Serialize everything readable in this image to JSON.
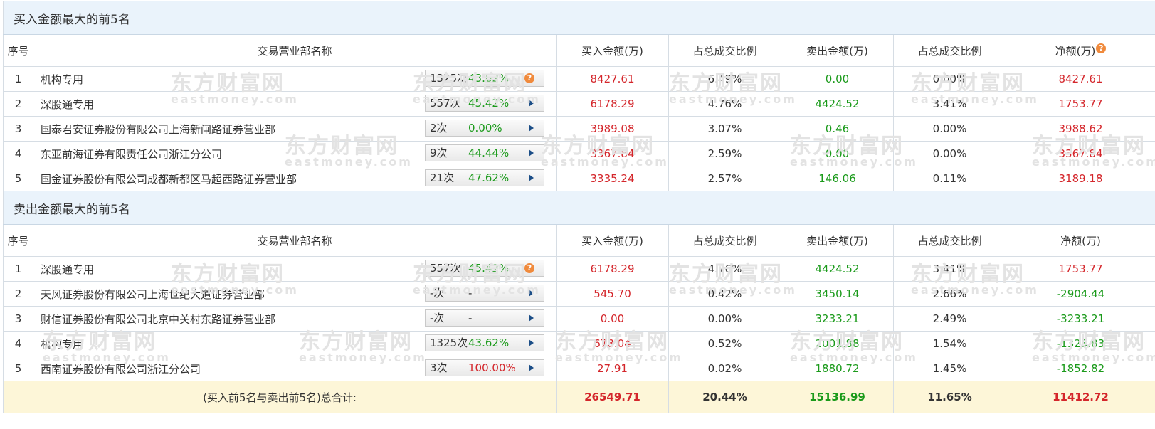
{
  "colors": {
    "up": "#d4262b",
    "down": "#1a9a1a",
    "header_bg": "#eaf3fb",
    "total_bg": "#fdf6d8"
  },
  "watermark": {
    "cn": "东方财富网",
    "en": "eastmoney.com"
  },
  "columns": [
    "序号",
    "交易营业部名称",
    "买入金额(万)",
    "占总成交比例",
    "卖出金额(万)",
    "占总成交比例",
    "净额(万)"
  ],
  "buy_section": {
    "title": "买入金额最大的前5名",
    "rows": [
      {
        "idx": "1",
        "name": "机构专用",
        "times": "1325次",
        "pct": "43.62%",
        "pct_color": "green",
        "icon": "question-icon",
        "buy": "8427.61",
        "buy_ratio": "6.49%",
        "sell": "0.00",
        "sell_ratio": "0.00%",
        "net": "8427.61",
        "net_color": "red"
      },
      {
        "idx": "2",
        "name": "深股通专用",
        "times": "557次",
        "pct": "45.42%",
        "pct_color": "green",
        "icon": "arrow-right-icon",
        "buy": "6178.29",
        "buy_ratio": "4.76%",
        "sell": "4424.52",
        "sell_ratio": "3.41%",
        "net": "1753.77",
        "net_color": "red"
      },
      {
        "idx": "3",
        "name": "国泰君安证券股份有限公司上海新闸路证券营业部",
        "times": "2次",
        "pct": "0.00%",
        "pct_color": "green",
        "icon": "arrow-right-icon",
        "buy": "3989.08",
        "buy_ratio": "3.07%",
        "sell": "0.46",
        "sell_ratio": "0.00%",
        "net": "3988.62",
        "net_color": "red"
      },
      {
        "idx": "4",
        "name": "东亚前海证券有限责任公司浙江分公司",
        "times": "9次",
        "pct": "44.44%",
        "pct_color": "green",
        "icon": "arrow-right-icon",
        "buy": "3367.84",
        "buy_ratio": "2.59%",
        "sell": "0.00",
        "sell_ratio": "0.00%",
        "net": "3367.84",
        "net_color": "red"
      },
      {
        "idx": "5",
        "name": "国金证券股份有限公司成都新都区马超西路证券营业部",
        "times": "21次",
        "pct": "47.62%",
        "pct_color": "green",
        "icon": "arrow-right-icon",
        "buy": "3335.24",
        "buy_ratio": "2.57%",
        "sell": "146.06",
        "sell_ratio": "0.11%",
        "net": "3189.18",
        "net_color": "red"
      }
    ]
  },
  "sell_section": {
    "title": "卖出金额最大的前5名",
    "rows": [
      {
        "idx": "1",
        "name": "深股通专用",
        "times": "557次",
        "pct": "45.42%",
        "pct_color": "green",
        "icon": "question-icon",
        "buy": "6178.29",
        "buy_ratio": "4.76%",
        "sell": "4424.52",
        "sell_ratio": "3.41%",
        "net": "1753.77",
        "net_color": "red"
      },
      {
        "idx": "2",
        "name": "天风证券股份有限公司上海世纪大道证券营业部",
        "times": "-次",
        "pct": "-",
        "pct_color": "dark",
        "icon": "arrow-right-icon",
        "buy": "545.70",
        "buy_ratio": "0.42%",
        "sell": "3450.14",
        "sell_ratio": "2.66%",
        "net": "-2904.44",
        "net_color": "green"
      },
      {
        "idx": "3",
        "name": "财信证券股份有限公司北京中关村东路证券营业部",
        "times": "-次",
        "pct": "-",
        "pct_color": "dark",
        "icon": "arrow-right-icon",
        "buy": "0.00",
        "buy_ratio": "0.00%",
        "sell": "3233.21",
        "sell_ratio": "2.49%",
        "net": "-3233.21",
        "net_color": "green"
      },
      {
        "idx": "4",
        "name": "机构专用",
        "times": "1325次",
        "pct": "43.62%",
        "pct_color": "green",
        "icon": "arrow-right-icon",
        "buy": "678.04",
        "buy_ratio": "0.52%",
        "sell": "2001.88",
        "sell_ratio": "1.54%",
        "net": "-1323.83",
        "net_color": "green"
      },
      {
        "idx": "5",
        "name": "西南证券股份有限公司浙江分公司",
        "times": "3次",
        "pct": "100.00%",
        "pct_color": "red",
        "icon": "arrow-right-icon",
        "buy": "27.91",
        "buy_ratio": "0.02%",
        "sell": "1880.72",
        "sell_ratio": "1.45%",
        "net": "-1852.82",
        "net_color": "green"
      }
    ]
  },
  "total": {
    "label": "(买入前5名与卖出前5名)总合计:",
    "buy": "26549.71",
    "buy_ratio": "20.44%",
    "sell": "15136.99",
    "sell_ratio": "11.65%",
    "net": "11412.72"
  }
}
